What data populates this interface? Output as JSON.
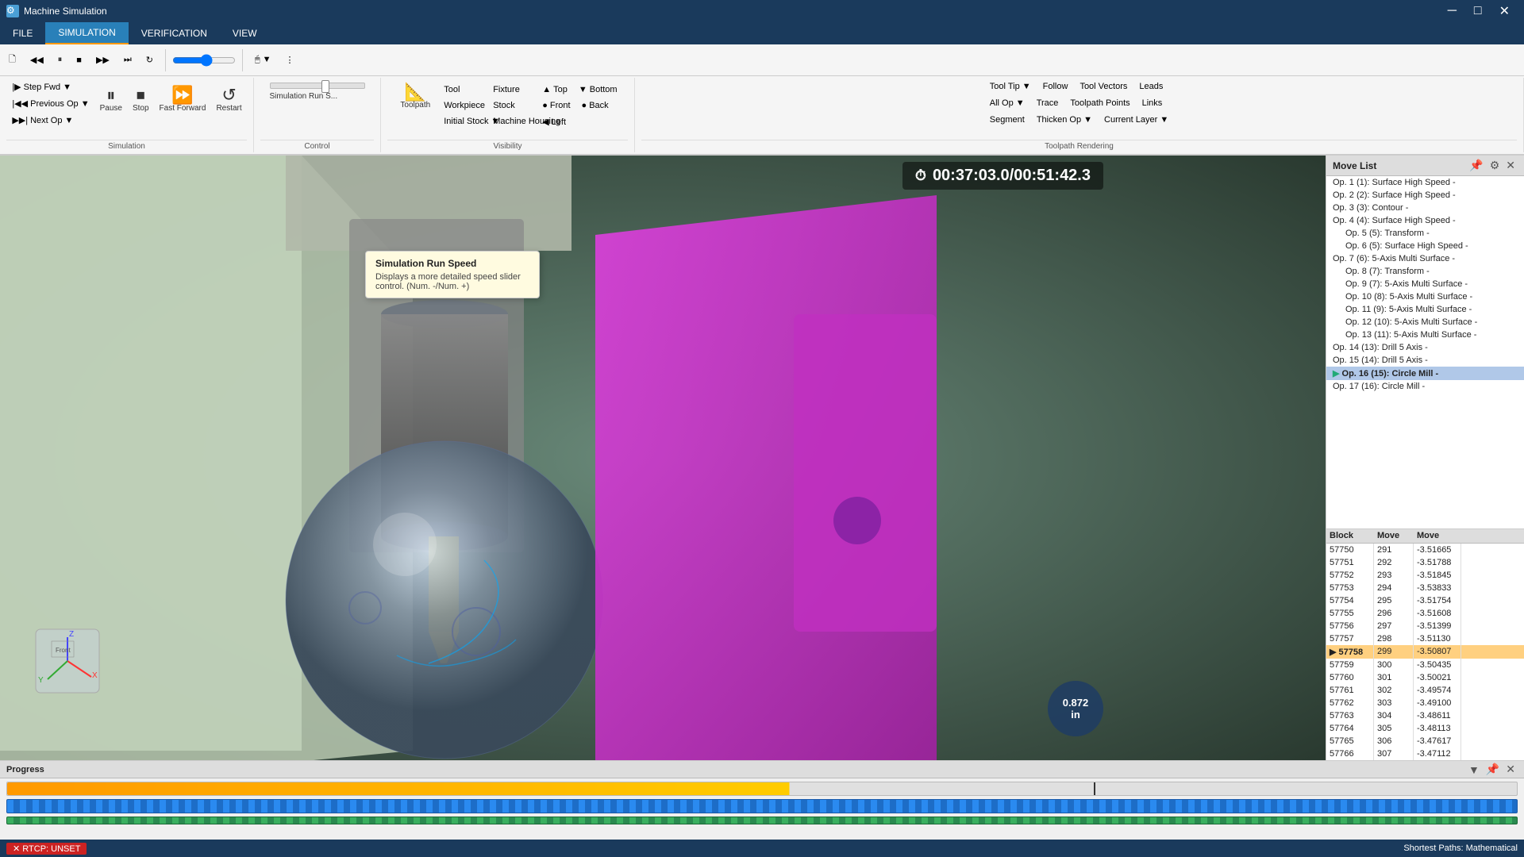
{
  "app": {
    "title": "Machine Simulation",
    "icon": "⚙"
  },
  "titlebar": {
    "minimize": "─",
    "maximize": "□",
    "close": "✕"
  },
  "menu": {
    "items": [
      "FILE",
      "SIMULATION",
      "VERIFICATION",
      "VIEW"
    ],
    "active": "SIMULATION"
  },
  "toolbar": {
    "back_label": "◀",
    "forward_label": "▶",
    "rewind_label": "⏮",
    "play_label": "⏭",
    "loop_label": "↻"
  },
  "simulation_group": {
    "label": "Simulation",
    "pause": "Pause",
    "stop": "Stop",
    "fast_fwd": "Fast Forward",
    "restart": "Restart",
    "step_fwd": "Step Fwd ▼",
    "prev_op": "Previous Op ▼",
    "next_op": "Next Op ▼"
  },
  "control_group": {
    "label": "Control",
    "sim_run_speed": "Simulation Run S..."
  },
  "tooltip": {
    "title": "Simulation Run Speed",
    "body": "Displays a more detailed speed slider control. (Num. -/Num. +)"
  },
  "visibility_group": {
    "label": "Visibility",
    "toolpath": "Toolpath",
    "tool": "Tool",
    "fixture": "Fixture",
    "workpiece": "Workpiece",
    "stock": "Stock",
    "initial_stock": "Initial Stock ▼",
    "machine_housing": "Machine Housing",
    "top": "Top",
    "bottom": "Bottom",
    "front": "Front",
    "back": "Back",
    "left": "Left"
  },
  "toolpath_rendering": {
    "label": "Toolpath Rendering",
    "tool_tip": "Tool Tip ▼",
    "follow": "Follow",
    "tool_vectors": "Tool Vectors",
    "leads": "Leads",
    "all_op": "All Op ▼",
    "trace": "Trace",
    "toolpath_points": "Toolpath Points",
    "links": "Links",
    "segment": "Segment",
    "thicken_op": "Thicken Op ▼",
    "current_layer": "Current Layer ▼"
  },
  "timer": {
    "elapsed": "00:37:03.0",
    "total": "00:51:42.3"
  },
  "move_list": {
    "title": "Move List",
    "operations": [
      "Op. 1 (1): Surface High Speed -",
      "Op. 2 (2): Surface High Speed -",
      "Op. 3 (3): Contour -",
      "Op. 4 (4): Surface High Speed -",
      "Op. 5 (5): Transform -",
      "Op. 6 (5): Surface High Speed -",
      "Op. 7 (6): 5-Axis Multi Surface -",
      "Op. 8 (7): Transform -",
      "Op. 9 (7): 5-Axis Multi Surface -",
      "Op. 10 (8): 5-Axis Multi Surface -",
      "Op. 11 (9): 5-Axis Multi Surface -",
      "Op. 12 (10): 5-Axis Multi Surface -",
      "Op. 13 (11): 5-Axis Multi Surface -",
      "Op. 14 (13): Drill 5 Axis -",
      "Op. 15 (14): Drill 5 Axis -",
      "Op. 16 (15): Circle Mill -",
      "Op. 17 (16): Circle Mill -"
    ],
    "active_op_index": 15
  },
  "move_table": {
    "columns": [
      "Block",
      "Move",
      "Move",
      ""
    ],
    "rows": [
      {
        "block": "57750",
        "move": "291",
        "val": "-3.51665",
        "extra": ""
      },
      {
        "block": "57751",
        "move": "292",
        "val": "-3.51788",
        "extra": ""
      },
      {
        "block": "57752",
        "move": "293",
        "val": "-3.51845",
        "extra": ""
      },
      {
        "block": "57753",
        "move": "294",
        "val": "-3.53833",
        "extra": ""
      },
      {
        "block": "57754",
        "move": "295",
        "val": "-3.51754",
        "extra": ""
      },
      {
        "block": "57755",
        "move": "296",
        "val": "-3.51608",
        "extra": ""
      },
      {
        "block": "57756",
        "move": "297",
        "val": "-3.51399",
        "extra": ""
      },
      {
        "block": "57757",
        "move": "298",
        "val": "-3.51130",
        "extra": ""
      },
      {
        "block": "57758",
        "move": "299",
        "val": "-3.50807",
        "extra": "",
        "highlighted": true
      },
      {
        "block": "57759",
        "move": "300",
        "val": "-3.50435",
        "extra": ""
      },
      {
        "block": "57760",
        "move": "301",
        "val": "-3.50021",
        "extra": ""
      },
      {
        "block": "57761",
        "move": "302",
        "val": "-3.49574",
        "extra": ""
      },
      {
        "block": "57762",
        "move": "303",
        "val": "-3.49100",
        "extra": ""
      },
      {
        "block": "57763",
        "move": "304",
        "val": "-3.48611",
        "extra": ""
      },
      {
        "block": "57764",
        "move": "305",
        "val": "-3.48113",
        "extra": ""
      },
      {
        "block": "57765",
        "move": "306",
        "val": "-3.47617",
        "extra": ""
      },
      {
        "block": "57766",
        "move": "307",
        "val": "-3.47112",
        "extra": ""
      }
    ]
  },
  "depth_indicator": {
    "value": "0.872",
    "unit": "in"
  },
  "progress": {
    "title": "Progress",
    "percent": 72
  },
  "statusbar": {
    "rtcp": "RTCP: UNSET",
    "shortest_paths": "Shortest Paths: Mathematical"
  }
}
